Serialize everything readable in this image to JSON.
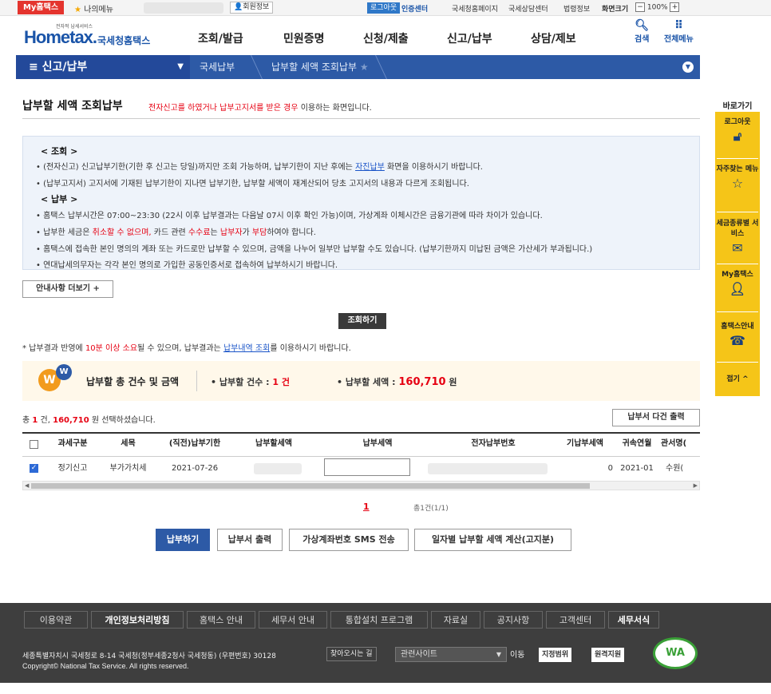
{
  "topbar": {
    "my_hometax": "My홈택스",
    "my_menu": "나의메뉴",
    "member_info": "회원정보",
    "logout": "로그아웃",
    "cert_center": "인증센터",
    "links": [
      "국세청홈페이지",
      "국세상담센터",
      "법령정보"
    ],
    "screen_size_label": "화면크기",
    "zoom": "100%",
    "minus": "−",
    "plus": "+"
  },
  "header": {
    "logo_small": "전자적 납세서비스",
    "logo_main": "Home",
    "logo_tax": "tax.",
    "logo_kor": "국세청홈택스",
    "gnb": [
      "조회/발급",
      "민원증명",
      "신청/제출",
      "신고/납부",
      "상담/제보"
    ],
    "search": "검색",
    "all_menu": "전체메뉴"
  },
  "navbar": {
    "title": "신고/납부",
    "crumbs": [
      "국세납부",
      "납부할 세액 조회납부"
    ]
  },
  "page": {
    "title": "납부할 세액 조회납부",
    "desc_red": "전자신고를 하였거나 납부고지서를 받은 경우",
    "desc_rest": " 이용하는 화면입니다."
  },
  "info": {
    "head_query": "< 조회 >",
    "q1_pre": "• (전자신고) 신고납부기한(기한 후 신고는 당일)까지만 조회 가능하며, 납부기한이 지난 후에는 ",
    "q1_link": "자진납부",
    "q1_post": " 화면을 이용하시기 바랍니다.",
    "q2": "• (납부고지서) 고지서에 기재된 납부기한이 지나면 납부기한, 납부할 세액이 재계산되어 당초 고지서의 내용과 다르게 조회됩니다.",
    "head_pay": "< 납부 >",
    "p1": "• 홈택스 납부시간은 07:00~23:30 (22시 이후 납부결과는 다음날 07시 이후 확인 가능)이며, 가상계좌 이체시간은 금융기관에 따라 차이가 있습니다.",
    "p2_pre": "• 납부한 세금은 ",
    "p2_red1": "취소할 수 없으며,",
    "p2_mid": " 카드 관련 ",
    "p2_red2": "수수료",
    "p2_mid2": "는 ",
    "p2_red3": "납부자",
    "p2_mid3": "가 ",
    "p2_red4": "부담",
    "p2_post": "하여야 합니다.",
    "p3": "• 홈택스에 접속한 본인 명의의 계좌 또는 카드로만 납부할 수 있으며, 금액을 나누어 일부만 납부할 수도 있습니다. (납부기한까지 미납된 금액은 가산세가 부과됩니다.)",
    "p4": "• 연대납세의무자는 각각 본인 명의로 가입한 공동인증서로 접속하여 납부하시기 바랍니다."
  },
  "buttons": {
    "more_info": "안내사항 더보기 +",
    "search": "조회하기",
    "multi_print": "납부서 다건 출력",
    "pay": "납부하기",
    "print": "납부서 출력",
    "sms": "가상계좌번호 SMS 전송",
    "daily_calc": "일자별 납부할 세액 계산(고지분)"
  },
  "notice": {
    "pre": "* 납부결과 반영에 ",
    "red": "10분 이상 소요",
    "mid": "될 수 있으며, 납부결과는 ",
    "link": "납부내역 조회",
    "post": "를 이용하시기 바랍니다."
  },
  "summary": {
    "title": "납부할 총 건수 및 금액",
    "count_label": "• 납부할 건수 : ",
    "count_value": "1 건",
    "amount_label": "• 납부할 세액 : ",
    "amount_value": "160,710",
    "amount_unit": " 원"
  },
  "selection": {
    "pre": "총 ",
    "count": "1",
    "mid": " 건, ",
    "amount": "160,710",
    "post": " 원 선택하셨습니다."
  },
  "table": {
    "headers": [
      "과세구분",
      "세목",
      "(직전)납부기한",
      "납부할세액",
      "납부세액",
      "전자납부번호",
      "기납부세액",
      "귀속연월",
      "관서명("
    ],
    "row": {
      "type": "정기신고",
      "tax": "부가가치세",
      "due": "2021-07-26",
      "paid": "0",
      "period": "2021-01",
      "office": "수원("
    }
  },
  "paging": {
    "page": "1",
    "count": "총1건(1/1)"
  },
  "quick": {
    "title": "바로가기",
    "items": [
      "로그아웃",
      "자주찾는 메뉴",
      "세금종류별 서비스",
      "My홈택스",
      "홈택스안내"
    ],
    "close": "접기 ^"
  },
  "footer": {
    "nav": [
      "이용약관",
      "개인정보처리방침",
      "홈택스 안내",
      "세무서 안내",
      "통합설치 프로그램",
      "자료실",
      "공지사항",
      "고객센터",
      "세무서식"
    ],
    "address": "세종특별자치시 국세청로 8-14 국세청(정부세종2청사 국세청동) (우편번호) 30128",
    "find_way": "찾아오시는 길",
    "related": "관련사이트",
    "go": "이동",
    "badge1": "지정범위",
    "badge2": "원격지원",
    "copyright": "Copyright© National Tax Service. All rights reserved.",
    "wa": "WA"
  }
}
